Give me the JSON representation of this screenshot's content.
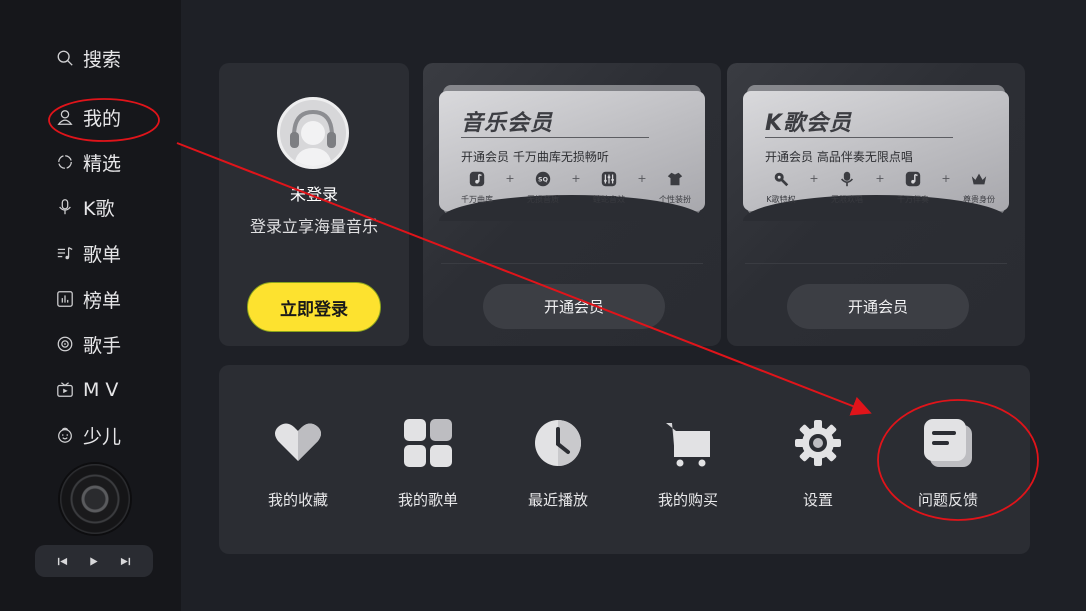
{
  "sidebar": {
    "items": [
      {
        "label": "搜索",
        "icon": "search-icon"
      },
      {
        "label": "我的",
        "icon": "user-icon"
      },
      {
        "label": "精选",
        "icon": "circle-icon"
      },
      {
        "label": "K歌",
        "icon": "microphone-icon"
      },
      {
        "label": "歌单",
        "icon": "playlist-icon"
      },
      {
        "label": "榜单",
        "icon": "chart-icon"
      },
      {
        "label": "歌手",
        "icon": "vinyl-icon"
      },
      {
        "label": "M V",
        "icon": "tv-icon"
      },
      {
        "label": "少儿",
        "icon": "kid-face-icon"
      }
    ],
    "player": {
      "prev": "previous-icon",
      "play": "play-icon",
      "next": "next-icon"
    }
  },
  "login": {
    "title": "未登录",
    "subtitle": "登录立享海量音乐",
    "button": "立即登录"
  },
  "vip_music": {
    "title": "音乐会员",
    "desc": "开通会员  千万曲库无损畅听",
    "perks": [
      "千万曲库",
      "无损音质",
      "蝰蛇音效",
      "个性装扮"
    ],
    "perk_icons": [
      "music-note-icon",
      "sq-badge-icon",
      "equalizer-icon",
      "shirt-icon"
    ],
    "sq_text": "SQ",
    "button": "开通会员"
  },
  "vip_k": {
    "title": "K歌会员",
    "desc": "开通会员  高品伴奏无限点唱",
    "perks": [
      "K歌特权",
      "无限欢唱",
      "千万伴奏",
      "尊贵身份"
    ],
    "perk_icons": [
      "wrench-icon",
      "microphone-icon",
      "music-note-icon",
      "crown-icon"
    ],
    "button": "开通会员"
  },
  "functions": [
    {
      "label": "我的收藏",
      "icon": "heart-icon"
    },
    {
      "label": "我的歌单",
      "icon": "grid-icon"
    },
    {
      "label": "最近播放",
      "icon": "clock-icon"
    },
    {
      "label": "我的购买",
      "icon": "cart-icon"
    },
    {
      "label": "设置",
      "icon": "gear-icon"
    },
    {
      "label": "问题反馈",
      "icon": "feedback-icon"
    }
  ],
  "colors": {
    "background": "#1e2026",
    "sidebar": "#16171b",
    "card": "#2b2d33",
    "accent_yellow": "#fde22f",
    "annotation_red": "#e0141a"
  }
}
